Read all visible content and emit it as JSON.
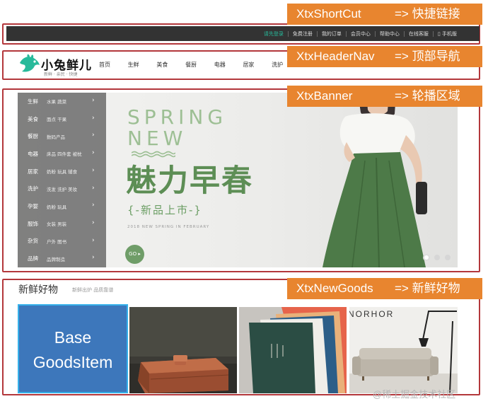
{
  "annotations": {
    "shortcut": {
      "name": "XtxShortCut",
      "arrow": "=> 快捷链接"
    },
    "header_nav": {
      "name": "XtxHeaderNav",
      "arrow": "=> 顶部导航"
    },
    "banner": {
      "name": "XtxBanner",
      "arrow": "=> 轮播区域"
    },
    "new_goods": {
      "name": "XtxNewGoods",
      "arrow": "=> 新鲜好物"
    }
  },
  "shortcut": {
    "links": [
      "请先登录",
      "免费注册",
      "我的订单",
      "会员中心",
      "帮助中心",
      "在线客服",
      "▯ 手机版"
    ]
  },
  "header": {
    "logo_name": "小兔鲜儿",
    "logo_slogan": "新鲜 · 亲民 · 快捷",
    "nav": [
      "首页",
      "生鲜",
      "美食",
      "餐厨",
      "电器",
      "居家",
      "洗护"
    ]
  },
  "banner": {
    "categories": [
      {
        "main": "生鲜",
        "sub": "水果 蔬菜"
      },
      {
        "main": "美食",
        "sub": "面点 干果"
      },
      {
        "main": "餐厨",
        "sub": "数码产品"
      },
      {
        "main": "电器",
        "sub": "床品 四件套 被枕"
      },
      {
        "main": "居家",
        "sub": "奶粉 玩具 辅食"
      },
      {
        "main": "洗护",
        "sub": "洗发 洗护 美妆"
      },
      {
        "main": "孕婴",
        "sub": "奶粉 玩具"
      },
      {
        "main": "服饰",
        "sub": "女装 男装"
      },
      {
        "main": "杂货",
        "sub": "户外 图书"
      },
      {
        "main": "品牌",
        "sub": "品牌制造"
      }
    ],
    "slide": {
      "line1": "SPRING",
      "line2": "NEW",
      "headline": "魅力早春",
      "subline": "{-新品上市-}",
      "eng": "2018 NEW SPRING IN FEBRUARY",
      "go": "GO"
    },
    "active_dot_index": 0,
    "dot_count": 3
  },
  "new_goods": {
    "title": "新鲜好物",
    "subtitle": "新鲜出炉 品质靠谱",
    "base_item_label": "Base GoodsItem",
    "book_cover_text": "NORHOR"
  },
  "watermark": "@稀土掘金技术社区",
  "colors": {
    "annotation_orange": "#e8852f",
    "box_red": "#b3373b",
    "brand_green": "#27ba9b",
    "slide_green": "#5d8e55",
    "base_blue": "#3d77bb"
  }
}
